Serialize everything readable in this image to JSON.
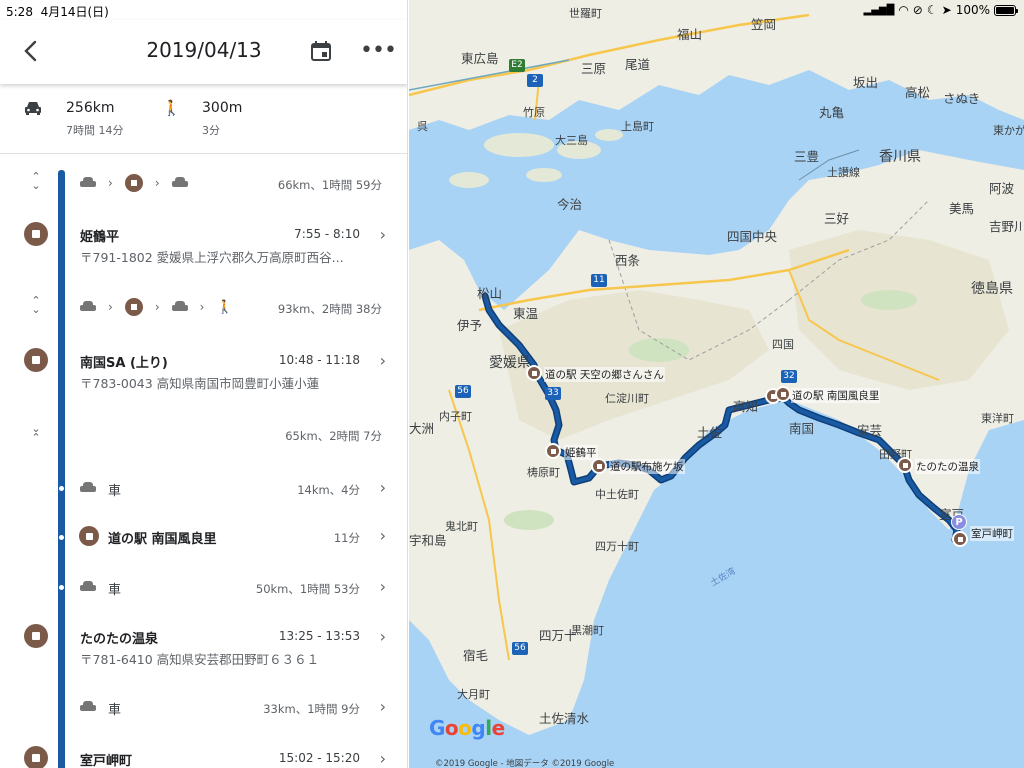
{
  "status_bar": {
    "time": "5:28",
    "date": "4月14日(日)",
    "battery": "100%"
  },
  "header": {
    "title": "2019/04/13",
    "back_icon": "back-arrow-icon",
    "calendar_icon": "calendar-icon",
    "more_icon": "more-horiz-icon"
  },
  "summary": {
    "drive_distance": "256km",
    "drive_duration": "7時間 14分",
    "walk_distance": "300m",
    "walk_duration": "3分"
  },
  "timeline": {
    "segment1": {
      "summary": "66km、1時間 59分"
    },
    "stop1": {
      "name": "姫鶴平",
      "time": "7:55 - 8:10",
      "address": "〒791-1802 愛媛県上浮穴郡久万高原町西谷..."
    },
    "segment2": {
      "summary": "93km、2時間 38分"
    },
    "stop2": {
      "name": "南国SA (上り)",
      "time": "10:48 - 11:18",
      "address": "〒783-0043 高知県南国市岡豊町小蓮小蓮"
    },
    "segment3": {
      "summary": "65km、2時間 7分",
      "sub1": {
        "label": "車",
        "summary": "14km、4分"
      },
      "sub_stop": {
        "label": "道の駅 南国風良里",
        "duration": "11分"
      },
      "sub2": {
        "label": "車",
        "summary": "50km、1時間 53分"
      }
    },
    "stop3": {
      "name": "たのたの温泉",
      "time": "13:25 - 13:53",
      "address": "〒781-6410 高知県安芸郡田野町６３６１"
    },
    "segment4": {
      "label": "車",
      "summary": "33km、1時間 9分"
    },
    "stop4": {
      "name": "室戸岬町",
      "time": "15:02 - 15:20"
    }
  },
  "map": {
    "place_labels": {
      "sera": "世羅町",
      "fukuyama": "福山",
      "kasaoka": "笠岡",
      "higashihiroshima": "東広島",
      "mihara": "三原",
      "onomichi": "尾道",
      "takehara": "竹原",
      "kure": "呉",
      "osakikamijima": "大三島",
      "kamijima": "上島町",
      "imabari": "今治",
      "marugame": "丸亀",
      "sakaide": "坂出",
      "takamatsu": "高松",
      "sanuki": "さぬき",
      "kagawa": "香川県",
      "higashikagawa": "東かがわ",
      "mitoyo": "三豊",
      "zentsuji": "善通寺",
      "miyoshi": "三好",
      "awa": "阿波",
      "yoshinogawa": "吉野川",
      "mima": "美馬",
      "tokushima": "徳島県",
      "shikokuchuo": "四国中央",
      "saijo": "西条",
      "toon": "東温",
      "matsuyama": "松山",
      "iyo": "伊予",
      "ehime": "愛媛県",
      "uchiko": "内子町",
      "ozu": "大洲",
      "niyodogawa": "仁淀川町",
      "yusuhara": "梼原町",
      "shikoku": "四国",
      "kochi": "高知",
      "nankoku": "南国",
      "tosa": "土佐",
      "konan": "香南",
      "aki": "安芸",
      "tano": "田野町",
      "toyo": "東洋町",
      "muroto": "室戸",
      "murotomisaki": "室戸岬町",
      "nakatosa": "中土佐町",
      "kihoku": "鬼北町",
      "uwajima": "宇和島",
      "shimanto": "四万十町",
      "shimanto_city": "四万十",
      "kuroshio": "黒潮町",
      "sukumo": "宿毛",
      "otsuki": "大月町",
      "tosashimizu": "土佐清水",
      "sakaide_kyo": "土讃線",
      "tosa_bay": "土佐湾"
    },
    "route_labels": {
      "tenku": "道の駅 天空の郷さんさん",
      "himetsuru": "姫鶴平",
      "yusuhara_road": "道の駅布施ケ坂",
      "nankoku_furari": "道の駅 南国風良里",
      "tanotano": "たのたの温泉",
      "muroto": "室戸岬町"
    },
    "road_shields": {
      "e2": "E2",
      "r2": "2",
      "r11": "11",
      "r33": "33",
      "r32": "32",
      "r56a": "56",
      "r56b": "56"
    },
    "parking": "P",
    "google": "Google",
    "copyright": "©2019 Google - 地図データ ©2019 Google"
  },
  "colors": {
    "route": "#1a5aa3",
    "stop_brown": "#7b5a4a",
    "sea": "#a8d3f5",
    "land": "#efeee4"
  }
}
